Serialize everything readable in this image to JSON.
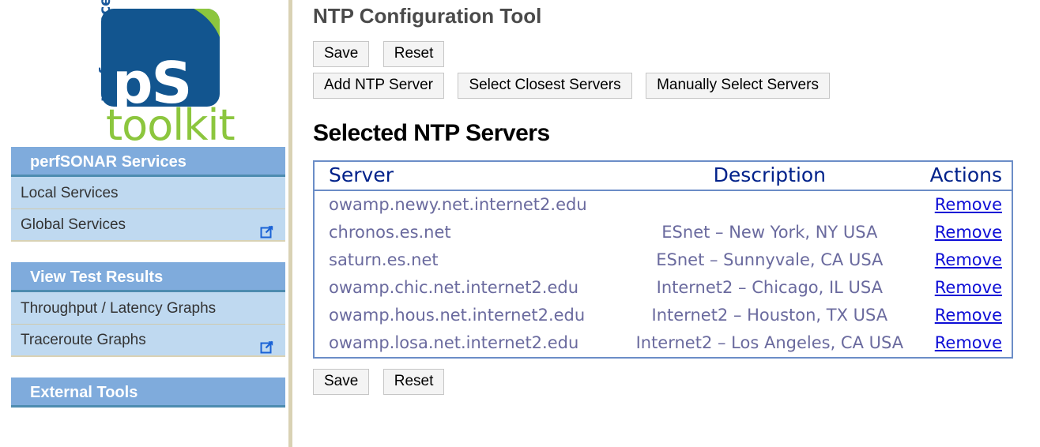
{
  "logo": {
    "vertical_word": "performance",
    "mark_text": "pS",
    "wordmark": "toolkit",
    "blue": "#12558f",
    "green": "#8cc63e"
  },
  "sidebar": {
    "groups": [
      {
        "header": "perfSONAR Services",
        "items": [
          {
            "label": "Local Services",
            "external": false
          },
          {
            "label": "Global Services",
            "external": true
          }
        ]
      },
      {
        "header": "View Test Results",
        "items": [
          {
            "label": "Throughput / Latency Graphs",
            "external": false
          },
          {
            "label": "Traceroute Graphs",
            "external": true
          }
        ]
      },
      {
        "header": "External Tools",
        "items": []
      }
    ]
  },
  "main": {
    "page_title": "NTP Configuration Tool",
    "buttons_top_row1": [
      {
        "label": "Save"
      },
      {
        "label": "Reset"
      }
    ],
    "buttons_top_row2": [
      {
        "label": "Add NTP Server"
      },
      {
        "label": "Select Closest Servers"
      },
      {
        "label": "Manually Select Servers"
      }
    ],
    "section_title": "Selected NTP Servers",
    "table": {
      "columns": [
        "Server",
        "Description",
        "Actions"
      ],
      "action_label": "Remove",
      "rows": [
        {
          "server": "owamp.newy.net.internet2.edu",
          "description": "",
          "action": "Remove"
        },
        {
          "server": "chronos.es.net",
          "description": "ESnet – New York, NY USA",
          "action": "Remove"
        },
        {
          "server": "saturn.es.net",
          "description": "ESnet – Sunnyvale, CA USA",
          "action": "Remove"
        },
        {
          "server": "owamp.chic.net.internet2.edu",
          "description": "Internet2 – Chicago, IL USA",
          "action": "Remove"
        },
        {
          "server": "owamp.hous.net.internet2.edu",
          "description": "Internet2 – Houston, TX USA",
          "action": "Remove"
        },
        {
          "server": "owamp.losa.net.internet2.edu",
          "description": "Internet2 – Los Angeles, CA USA",
          "action": "Remove"
        }
      ]
    },
    "buttons_bottom": [
      {
        "label": "Save"
      },
      {
        "label": "Reset"
      }
    ]
  },
  "colors": {
    "nav_header_bg": "#7fabdc",
    "nav_item_bg": "#bfd9f0",
    "table_border": "#6b8dc7",
    "table_header_text": "#00218a",
    "table_cell_text": "#6a6a9e",
    "link": "#0d0dd6"
  }
}
